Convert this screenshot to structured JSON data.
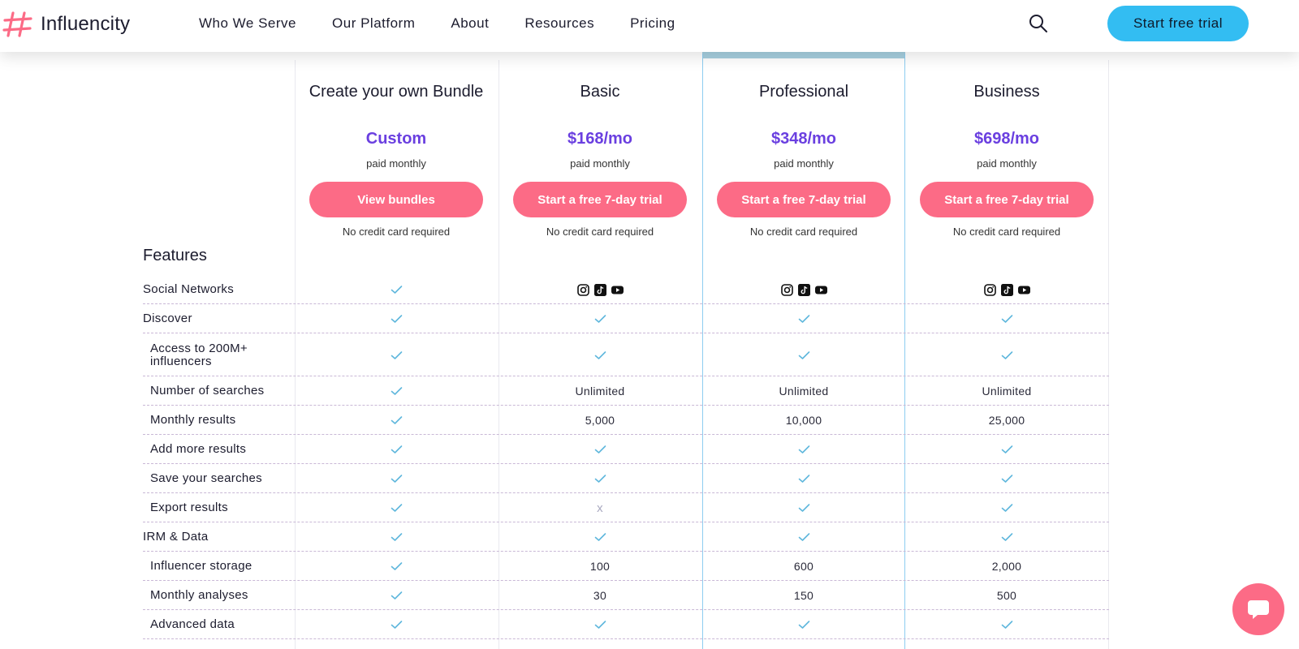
{
  "brand": {
    "name": "Influencity",
    "accent": "#fc6b86",
    "cta_color": "#33bdf2",
    "price_color": "#6a3fe0"
  },
  "nav": {
    "items": [
      "Who We Serve",
      "Our Platform",
      "About",
      "Resources",
      "Pricing"
    ],
    "search_icon": "search-icon",
    "cta_label": "Start free trial"
  },
  "plans": [
    {
      "name": "Create your own Bundle",
      "price": "Custom",
      "period": "paid monthly",
      "button": "View bundles",
      "note": "No credit card required"
    },
    {
      "name": "Basic",
      "price": "$168/mo",
      "period": "paid monthly",
      "button": "Start a free 7-day trial",
      "note": "No credit card required"
    },
    {
      "name": "Professional",
      "price": "$348/mo",
      "period": "paid monthly",
      "button": "Start a free 7-day trial",
      "note": "No credit card required",
      "highlighted": true
    },
    {
      "name": "Business",
      "price": "$698/mo",
      "period": "paid monthly",
      "button": "Start a free 7-day trial",
      "note": "No credit card required"
    }
  ],
  "features": {
    "heading": "Features",
    "rows": [
      {
        "label": "Social Networks",
        "group": true,
        "cells": [
          "check",
          "social",
          "social",
          "social"
        ]
      },
      {
        "label": "Discover",
        "group": true,
        "cells": [
          "check",
          "check",
          "check",
          "check"
        ]
      },
      {
        "label": "Access to 200M+ influencers",
        "group": false,
        "cells": [
          "check",
          "check",
          "check",
          "check"
        ]
      },
      {
        "label": "Number of searches",
        "group": false,
        "cells": [
          "check",
          "Unlimited",
          "Unlimited",
          "Unlimited"
        ]
      },
      {
        "label": "Monthly results",
        "group": false,
        "cells": [
          "check",
          "5,000",
          "10,000",
          "25,000"
        ]
      },
      {
        "label": "Add more results",
        "group": false,
        "cells": [
          "check",
          "check",
          "check",
          "check"
        ]
      },
      {
        "label": "Save your searches",
        "group": false,
        "cells": [
          "check",
          "check",
          "check",
          "check"
        ]
      },
      {
        "label": "Export results",
        "group": false,
        "cells": [
          "check",
          "x",
          "check",
          "check"
        ]
      },
      {
        "label": "IRM & Data",
        "group": true,
        "cells": [
          "check",
          "check",
          "check",
          "check"
        ]
      },
      {
        "label": "Influencer storage",
        "group": false,
        "cells": [
          "check",
          "100",
          "600",
          "2,000"
        ]
      },
      {
        "label": "Monthly analyses",
        "group": false,
        "cells": [
          "check",
          "30",
          "150",
          "500"
        ]
      },
      {
        "label": "Advanced data",
        "group": false,
        "cells": [
          "check",
          "check",
          "check",
          "check"
        ]
      }
    ]
  },
  "social_icons": [
    "instagram-icon",
    "tiktok-icon",
    "youtube-icon"
  ],
  "x_glyph": "x",
  "chat_icon": "chat-icon"
}
